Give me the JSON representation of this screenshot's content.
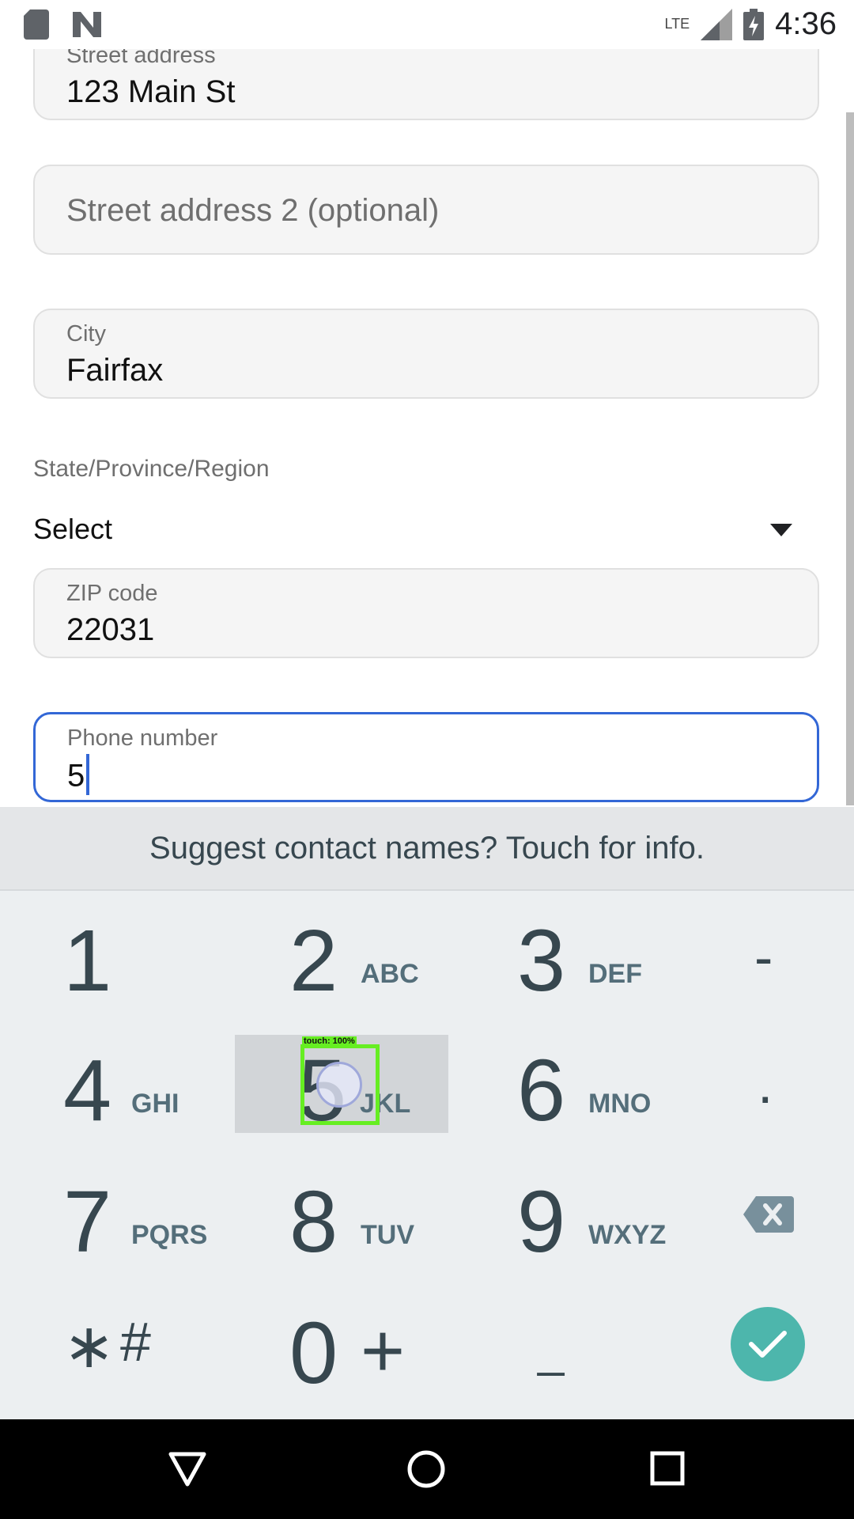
{
  "status_bar": {
    "time": "4:36",
    "network": "LTE",
    "icons": [
      "sd-card-icon",
      "n-logo-icon",
      "signal-icon",
      "battery-charging-icon"
    ]
  },
  "form": {
    "street_address": {
      "label": "Street address",
      "value": "123 Main St"
    },
    "street_address_2": {
      "placeholder": "Street address 2 (optional)"
    },
    "city": {
      "label": "City",
      "value": "Fairfax"
    },
    "state": {
      "label": "State/Province/Region",
      "value": "Select"
    },
    "zip": {
      "label": "ZIP code",
      "value": "22031"
    },
    "phone": {
      "label": "Phone number",
      "value": "5"
    }
  },
  "keyboard": {
    "suggestion": "Suggest contact names? Touch for info.",
    "keys": [
      {
        "num": "1",
        "letters": ""
      },
      {
        "num": "2",
        "letters": "ABC"
      },
      {
        "num": "3",
        "letters": "DEF"
      },
      {
        "num": "4",
        "letters": "GHI"
      },
      {
        "num": "5",
        "letters": "JKL"
      },
      {
        "num": "6",
        "letters": "MNO"
      },
      {
        "num": "7",
        "letters": "PQRS"
      },
      {
        "num": "8",
        "letters": "TUV"
      },
      {
        "num": "9",
        "letters": "WXYZ"
      },
      {
        "num": "0",
        "letters": "+"
      }
    ],
    "symbols": {
      "dash": "-",
      "period": ".",
      "star": "∗",
      "hash": "#",
      "space": "_"
    },
    "touch_label": "touch: 100%"
  },
  "nav_icons": [
    "back-icon",
    "home-icon",
    "recents-icon"
  ],
  "colors": {
    "accent": "#3367d6",
    "done": "#4db6ac",
    "touch": "#66ee22"
  }
}
